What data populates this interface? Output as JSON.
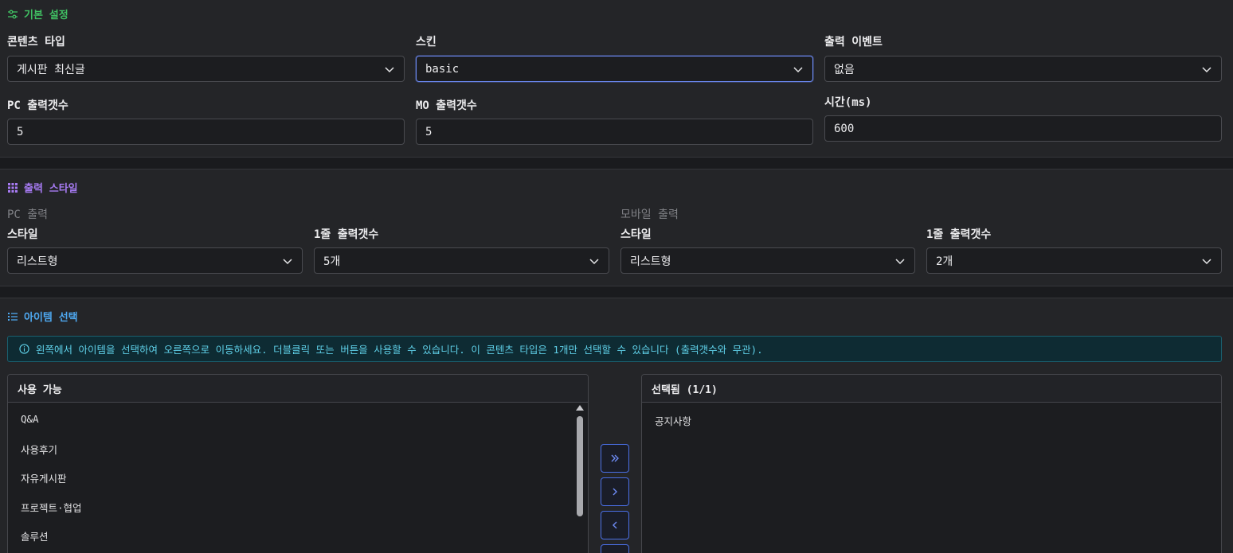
{
  "basic": {
    "title": "기본 설정",
    "content_type": {
      "label": "콘텐츠 타입",
      "value": "게시판 최신글"
    },
    "skin": {
      "label": "스킨",
      "value": "basic"
    },
    "event": {
      "label": "출력 이벤트",
      "value": "없음"
    },
    "pc_count": {
      "label": "PC 출력갯수",
      "value": "5"
    },
    "mo_count": {
      "label": "MO 출력갯수",
      "value": "5"
    },
    "time": {
      "label": "시간(ms)",
      "value": "600"
    }
  },
  "style": {
    "title": "출력 스타일",
    "pc": {
      "heading": "PC 출력",
      "style_label": "스타일",
      "style_value": "리스트형",
      "row_label": "1줄 출력갯수",
      "row_value": "5개"
    },
    "mobile": {
      "heading": "모바일 출력",
      "style_label": "스타일",
      "style_value": "리스트형",
      "row_label": "1줄 출력갯수",
      "row_value": "2개"
    }
  },
  "items": {
    "title": "아이템 선택",
    "info": "왼쪽에서 아이템을 선택하여 오른쪽으로 이동하세요. 더블클릭 또는 버튼을 사용할 수 있습니다. 이 콘텐츠 타입은 1개만 선택할 수 있습니다 (출력갯수와 무관).",
    "available_title": "사용 가능",
    "available": [
      "Q&A",
      "사용후기",
      "자유게시판",
      "프로젝트·협업",
      "솔루션"
    ],
    "selected_title": "선택됨 (1/1)",
    "selected": [
      "공지사항"
    ],
    "buttons": [
      "»",
      "›",
      "‹"
    ]
  },
  "colors": {
    "green": "#40c063",
    "purple": "#a77bf3",
    "blue": "#4ea8f0",
    "accent": "#6d8bf5",
    "info": "#5fd0e8"
  }
}
